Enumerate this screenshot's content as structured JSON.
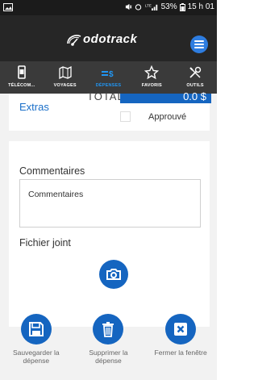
{
  "status_bar": {
    "text": "53%",
    "time": "15 h 01"
  },
  "app": {
    "logo_text": "odotrack"
  },
  "tabs": [
    {
      "label": "TÉLÉCOM...",
      "icon": "device-icon"
    },
    {
      "label": "VOYAGES",
      "icon": "map-icon"
    },
    {
      "label": "DÉPENSES",
      "icon": "expense-icon"
    },
    {
      "label": "FAVORIS",
      "icon": "star-icon"
    },
    {
      "label": "OUTILS",
      "icon": "tools-icon"
    }
  ],
  "expense": {
    "total_label": "TOTAL",
    "total_value": "0.0 $",
    "approve_label": "Approuvé"
  },
  "extras": {
    "title": "Extras",
    "comment_label": "Commentaires",
    "comment_placeholder": "Commentaires",
    "file_label": "Fichier joint"
  },
  "actions": [
    {
      "label": "Sauvegarder la dépense",
      "icon": "save-icon"
    },
    {
      "label": "Supprimer la dépense",
      "icon": "trash-icon"
    },
    {
      "label": "Fermer la fenêtre",
      "icon": "close-icon"
    }
  ],
  "colors": {
    "accent": "#1565c0",
    "tab_active": "#2196f3",
    "extras_title": "#1a6fc9"
  }
}
